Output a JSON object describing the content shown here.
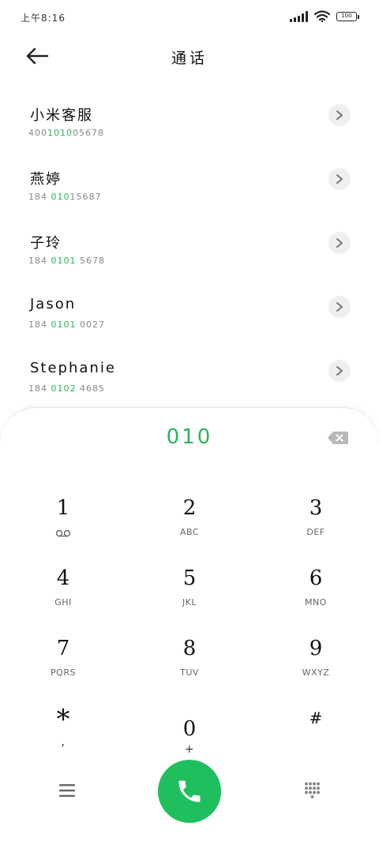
{
  "status_bar": {
    "time": "上午8:16",
    "battery": "100",
    "icons": [
      "signal-icon",
      "wifi-icon",
      "battery-icon"
    ]
  },
  "header": {
    "back_icon": "arrow-left-icon",
    "title": "通话"
  },
  "contacts": [
    {
      "name": "小米客服",
      "number_pre": "400",
      "number_hl": "1010",
      "number_post": "05678"
    },
    {
      "name": "燕婷",
      "number_pre": "184 ",
      "number_hl": "010",
      "number_post": "15687"
    },
    {
      "name": "子玲",
      "number_pre": "184 ",
      "number_hl": "0101",
      "number_post": " 5678"
    },
    {
      "name": "Jason",
      "number_pre": "184 ",
      "number_hl": "0101",
      "number_post": " 0027"
    },
    {
      "name": "Stephanie",
      "number_pre": "184 ",
      "number_hl": "0102",
      "number_post": " 4685"
    }
  ],
  "dialer": {
    "entered": "010",
    "backspace_icon": "backspace-icon",
    "keys": [
      {
        "digit": "1",
        "letters": "",
        "icon": "voicemail-icon"
      },
      {
        "digit": "2",
        "letters": "ABC"
      },
      {
        "digit": "3",
        "letters": "DEF"
      },
      {
        "digit": "4",
        "letters": "GHI"
      },
      {
        "digit": "5",
        "letters": "JKL"
      },
      {
        "digit": "6",
        "letters": "MNO"
      },
      {
        "digit": "7",
        "letters": "PQRS"
      },
      {
        "digit": "8",
        "letters": "TUV"
      },
      {
        "digit": "9",
        "letters": "WXYZ"
      },
      {
        "digit": "*",
        "letters": ","
      },
      {
        "digit": "0",
        "letters": "+"
      },
      {
        "digit": "#",
        "letters": ""
      }
    ],
    "menu_icon": "menu-icon",
    "call_icon": "phone-icon",
    "keypad_icon": "dialpad-icon"
  },
  "colors": {
    "accent": "#2db35d",
    "call_button": "#1fbf5e"
  }
}
